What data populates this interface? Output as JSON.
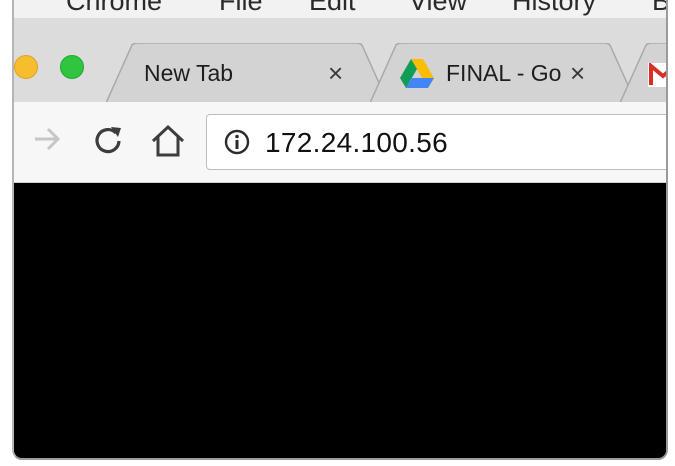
{
  "menubar": {
    "items": [
      "Chrome",
      "File",
      "Edit",
      "View",
      "History",
      "B"
    ]
  },
  "window": {
    "controls": [
      "minimize",
      "zoom"
    ]
  },
  "tabs": [
    {
      "title": "New Tab",
      "active": false,
      "icon": "none",
      "close": "×"
    },
    {
      "title": "FINAL - Go",
      "active": false,
      "icon": "google-drive-icon",
      "close": "×"
    },
    {
      "title": "",
      "active": false,
      "icon": "gmail-icon",
      "close": ""
    }
  ],
  "toolbar": {
    "forward": "forward-arrow-icon",
    "reload": "reload-icon",
    "home": "home-icon"
  },
  "omnibox": {
    "icon": "info-icon",
    "url": "172.24.100.56"
  },
  "colors": {
    "traffic_yellow": "#f6bd2f",
    "traffic_green": "#2fc53f",
    "page_background": "#000000",
    "gmail_red": "#d93025"
  }
}
